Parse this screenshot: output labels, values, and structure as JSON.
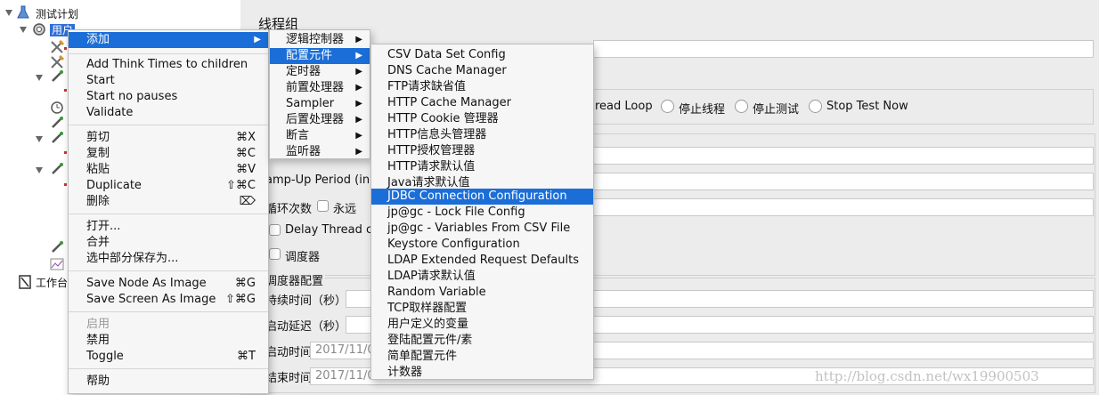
{
  "tree": {
    "root_label": "测试计划",
    "selected_label": "用户",
    "workbench_label": "工作台"
  },
  "panel": {
    "title": "线程组",
    "radio_thread_loop": "read Loop",
    "radio_stop_thread": "停止线程",
    "radio_stop_test": "停止测试",
    "radio_stop_now": "Stop Test Now",
    "rampup_label": "amp-Up Period (in s",
    "loop_label": "循环次数",
    "forever_label": "永远",
    "delay_label": "Delay Thread cre",
    "scheduler_label": "调度器",
    "scheduler_group": "调度器配置",
    "duration_label": "持续时间（秒）",
    "startup_delay_label": "启动延迟（秒）",
    "start_time_label": "启动时间",
    "start_time_value": "2017/11/0",
    "end_time_label": "结束时间",
    "end_time_value": "2017/11/0"
  },
  "context_menu": {
    "add": "添加",
    "group1": [
      "Add Think Times to children",
      "Start",
      "Start no pauses",
      "Validate"
    ],
    "cut": "剪切",
    "cut_sc": "⌘X",
    "copy": "复制",
    "copy_sc": "⌘C",
    "paste": "粘贴",
    "paste_sc": "⌘V",
    "duplicate": "Duplicate",
    "duplicate_sc": "⇧⌘C",
    "delete": "删除",
    "delete_sc": "⌦",
    "open": "打开...",
    "merge": "合并",
    "save_part": "选中部分保存为...",
    "save_node_image": "Save Node As Image",
    "save_node_image_sc": "⌘G",
    "save_screen_image": "Save Screen As Image",
    "save_screen_image_sc": "⇧⌘G",
    "enable": "启用",
    "disable": "禁用",
    "toggle": "Toggle",
    "toggle_sc": "⌘T",
    "help": "帮助"
  },
  "submenu_add": [
    "逻辑控制器",
    "配置元件",
    "定时器",
    "前置处理器",
    "Sampler",
    "后置处理器",
    "断言",
    "监听器"
  ],
  "submenu_config": [
    "CSV Data Set Config",
    "DNS Cache Manager",
    "FTP请求缺省值",
    "HTTP Cache Manager",
    "HTTP Cookie 管理器",
    "HTTP信息头管理器",
    "HTTP授权管理器",
    "HTTP请求默认值",
    "Java请求默认值",
    "JDBC Connection Configuration",
    "jp@gc - Lock File Config",
    "jp@gc - Variables From CSV File",
    "Keystore Configuration",
    "LDAP Extended Request Defaults",
    "LDAP请求默认值",
    "Random Variable",
    "TCP取样器配置",
    "用户定义的变量",
    "登陆配置元件/素",
    "简单配置元件",
    "计数器"
  ],
  "watermark": "http://blog.csdn.net/wx19900503",
  "colors": {
    "highlight": "#1b6ed7",
    "menu_bg": "#f6f6f6"
  }
}
